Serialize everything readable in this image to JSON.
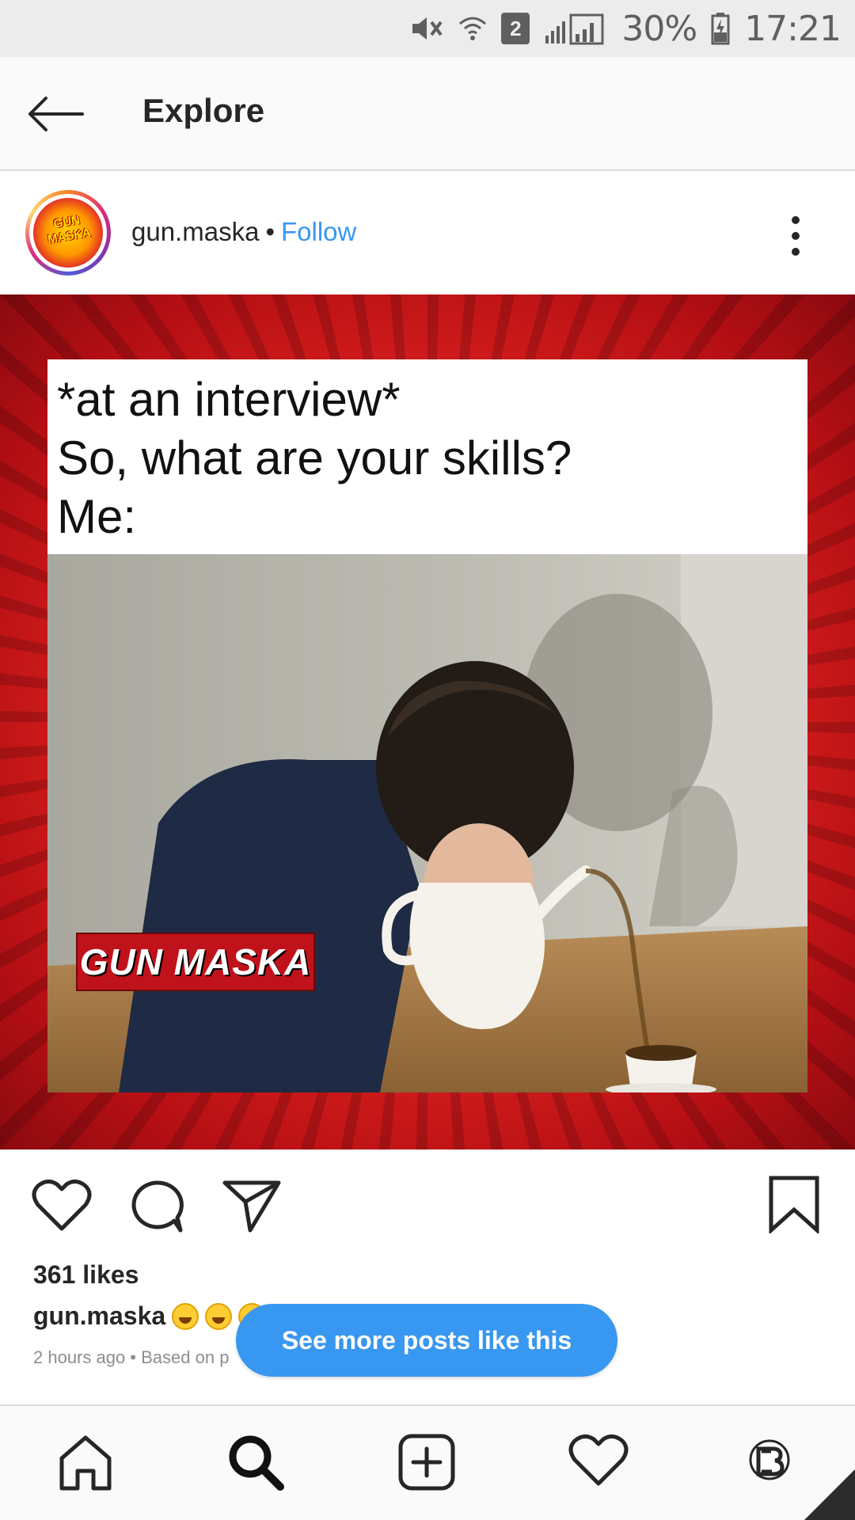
{
  "status_bar": {
    "sim_number": "2",
    "battery": "30%",
    "time": "17:21"
  },
  "header": {
    "title": "Explore"
  },
  "post": {
    "username": "gun.maska",
    "separator": "•",
    "follow_label": "Follow",
    "avatar_text": "GUN MASKA",
    "meme_lines": [
      "*at an interview*",
      "So, what are your skills?",
      "Me:"
    ],
    "watermark": "GUN MASKA",
    "likes": "361 likes",
    "caption_user": "gun.maska",
    "meta": "2 hours ago • Based on p"
  },
  "cta": {
    "label": "See more posts like this"
  },
  "icons": {
    "back": "back-arrow-icon",
    "more": "more-vertical-icon",
    "like": "heart-icon",
    "comment": "comment-icon",
    "share": "send-icon",
    "save": "bookmark-icon",
    "home": "home-icon",
    "search": "search-icon",
    "add": "add-post-icon",
    "activity": "heart-icon",
    "profile": "profile-icon"
  },
  "colors": {
    "accent": "#3897f0",
    "post_background": "#e3231f",
    "watermark": "#c0121b"
  }
}
